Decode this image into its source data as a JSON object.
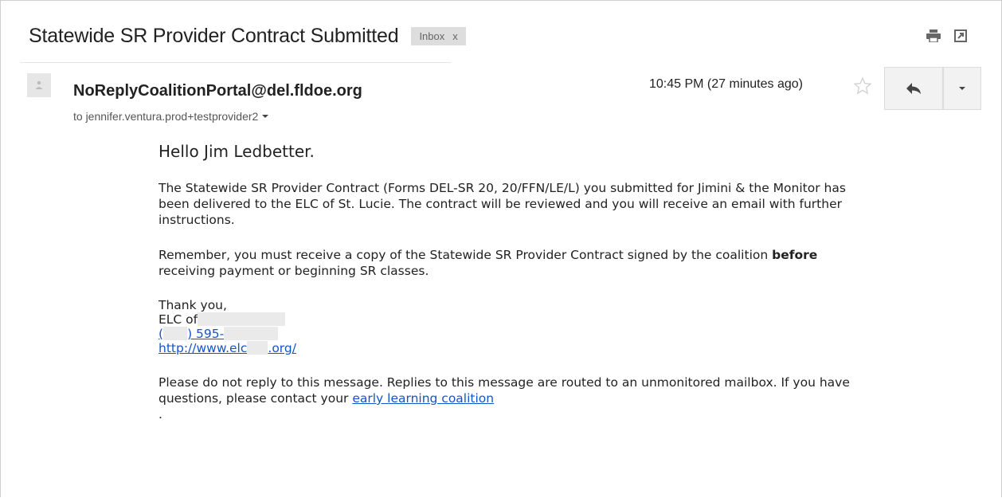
{
  "email": {
    "subject": "Statewide SR Provider Contract Submitted",
    "label": "Inbox",
    "label_remove": "x",
    "sender": "NoReplyCoalitionPortal@del.fldoe.org",
    "to_line": "to jennifer.ventura.prod+testprovider2",
    "time": "10:45 PM (27 minutes ago)"
  },
  "toolbar": {
    "print_icon": "printer-icon",
    "popout_icon": "open-in-new-window-icon",
    "reply_icon": "reply-arrow-icon",
    "more_icon": "chevron-down-icon",
    "star_icon": "star-outline-icon"
  },
  "body": {
    "greeting": "Hello Jim Ledbetter.",
    "para1": "The Statewide SR Provider Contract (Forms DEL-SR 20, 20/FFN/LE/L) you submitted for Jimini & the Monitor has been delivered to the ELC of St. Lucie. The contract will be reviewed and you will receive an email with further instructions.",
    "para2_a": "Remember, you must receive a copy of the Statewide SR Provider Contract signed by the coalition ",
    "para2_bold": "before",
    "para2_b": " receiving payment or beginning SR classes.",
    "sig_thanks": "Thank you,",
    "sig_elc": "ELC of",
    "sig_phone_a": "(",
    "sig_phone_b": ") 595-",
    "sig_url_a": "http://www.elc",
    "sig_url_b": ".org/",
    "footer_text": "Please do not reply to this message. Replies to this message are routed to an unmonitored mailbox. If you have questions, please contact your ",
    "footer_link": "early learning coalition",
    "footer_end": "."
  },
  "colors": {
    "link": "#1155cc",
    "chip_bg": "#dddddd",
    "button_bg": "#f2f2f2"
  }
}
